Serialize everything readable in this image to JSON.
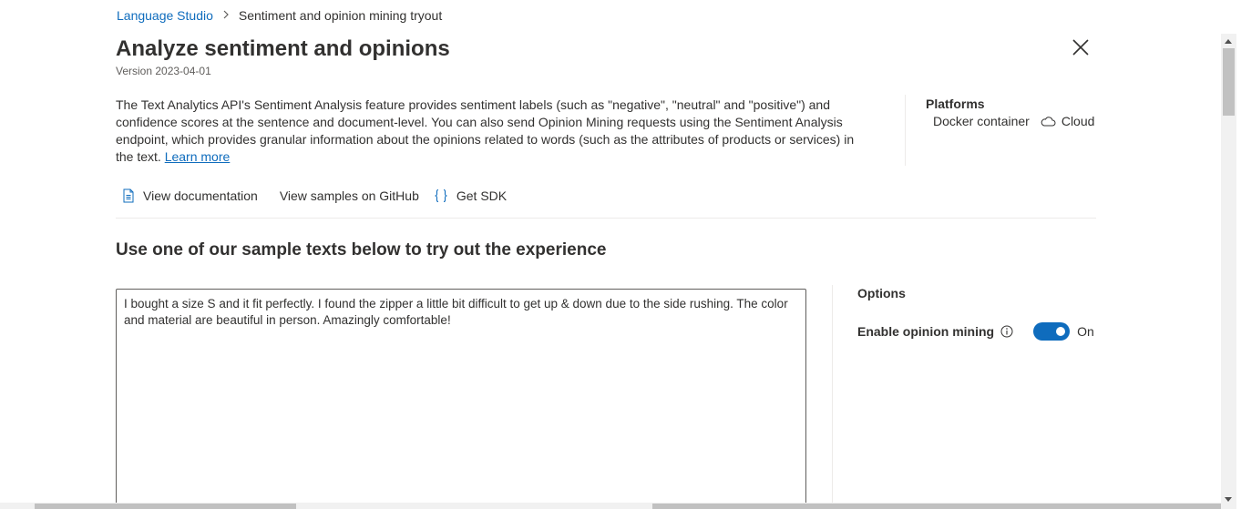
{
  "breadcrumb": {
    "root": "Language Studio",
    "separator": ">",
    "current": "Sentiment and opinion mining tryout"
  },
  "header": {
    "title": "Analyze sentiment and opinions",
    "version": "Version 2023-04-01",
    "close_icon": "close-icon"
  },
  "description": {
    "text": "The Text Analytics API's Sentiment Analysis feature provides sentiment labels (such as \"negative\", \"neutral\" and \"positive\") and confidence scores at the sentence and document-level. You can also send Opinion Mining requests using the Sentiment Analysis endpoint, which provides granular information about the opinions related to words (such as the attributes of products or services) in the text.",
    "learn_more": "Learn more"
  },
  "platforms": {
    "title": "Platforms",
    "docker": "Docker container",
    "cloud": "Cloud",
    "cloud_icon": "cloud-icon"
  },
  "links": {
    "documentation": "View documentation",
    "documentation_icon": "document-icon",
    "github": "View samples on GitHub",
    "sdk": "Get SDK",
    "sdk_icon": "braces-icon"
  },
  "main": {
    "heading": "Use one of our sample texts below to try out the experience",
    "sample_text": "I bought a size S and it fit perfectly. I found the zipper a little bit difficult to get up & down due to the side rushing. The color and material are beautiful in person. Amazingly comfortable!"
  },
  "options": {
    "title": "Options",
    "opinion_mining_label": "Enable opinion mining",
    "info_icon": "info-icon",
    "toggle_state": "On",
    "toggle_on": true
  },
  "colors": {
    "accent": "#0f6cbd",
    "text": "#323130",
    "divider": "#edebe9"
  }
}
